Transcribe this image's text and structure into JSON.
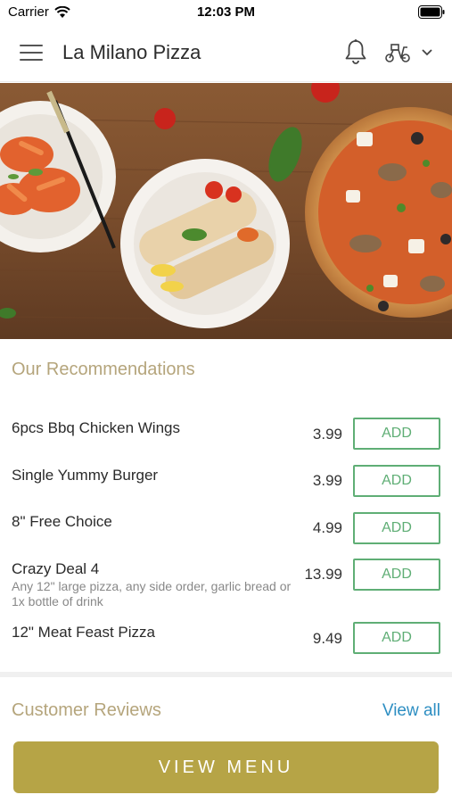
{
  "status_bar": {
    "carrier": "Carrier",
    "time": "12:03 PM"
  },
  "header": {
    "title": "La Milano Pizza"
  },
  "icons": {
    "menu": "hamburger-menu-icon",
    "bell": "bell-icon",
    "scooter": "delivery-scooter-icon",
    "chevron": "chevron-down-icon",
    "wifi": "wifi-icon",
    "battery": "battery-icon"
  },
  "recommendations": {
    "title": "Our Recommendations",
    "add_label": "ADD",
    "items": [
      {
        "name": "6pcs Bbq Chicken Wings",
        "price": "3.99",
        "description": ""
      },
      {
        "name": "Single Yummy Burger",
        "price": "3.99",
        "description": ""
      },
      {
        "name": "8\" Free Choice",
        "price": "4.99",
        "description": ""
      },
      {
        "name": "Crazy Deal 4",
        "price": "13.99",
        "description": "Any 12\" large pizza, any side order, garlic bread or 1x bottle of drink"
      },
      {
        "name": "12\" Meat Feast Pizza",
        "price": "9.49",
        "description": ""
      }
    ]
  },
  "reviews": {
    "title": "Customer Reviews",
    "view_all": "View all"
  },
  "footer": {
    "button_label": "VIEW MENU"
  },
  "colors": {
    "accent_gold": "#b6a446",
    "section_title": "#b5a57c",
    "add_green": "#5fae75",
    "link_blue": "#2d8ec2"
  }
}
